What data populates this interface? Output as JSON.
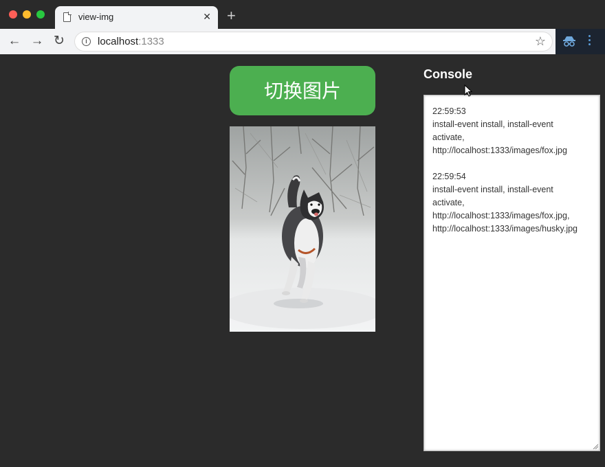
{
  "browser": {
    "tab": {
      "title": "view-img",
      "close_glyph": "✕",
      "icon": "document-icon"
    },
    "new_tab_glyph": "+",
    "toolbar": {
      "back_glyph": "←",
      "forward_glyph": "→",
      "reload_glyph": "↻",
      "info_glyph": "i",
      "url_host": "localhost",
      "url_port": ":1333",
      "bookmark_glyph": "☆"
    },
    "colors": {
      "close": "#fe5f57",
      "minimize": "#febc2e",
      "maximize": "#28c840"
    }
  },
  "page": {
    "switch_button_label": "切换图片",
    "image": {
      "subject": "husky running in snow",
      "icon": "husky-image"
    },
    "console": {
      "title": "Console",
      "entries": [
        {
          "time": "22:59:53",
          "lines": [
            "install-event install, install-event",
            "activate,",
            "http://localhost:1333/images/fox.jpg"
          ]
        },
        {
          "time": "22:59:54",
          "lines": [
            "install-event install, install-event",
            "activate,",
            "http://localhost:1333/images/fox.jpg,",
            "http://localhost:1333/images/husky.jpg"
          ]
        }
      ]
    },
    "colors": {
      "background": "#2b2b2b",
      "button": "#4caf50"
    }
  }
}
